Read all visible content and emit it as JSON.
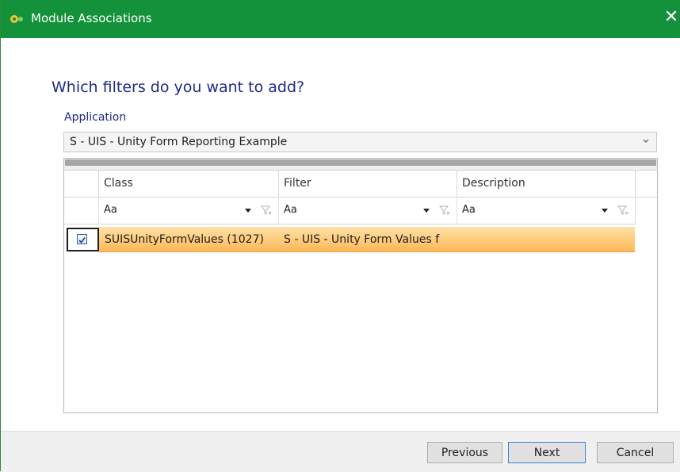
{
  "window": {
    "title": "Module Associations",
    "close_glyph": "✕"
  },
  "heading": "Which filters do you want to add?",
  "application": {
    "label": "Application",
    "selected": "S - UIS - Unity Form Reporting Example"
  },
  "grid": {
    "columns": [
      "Class",
      "Filter",
      "Description"
    ],
    "filter_placeholder": "Aa",
    "rows": [
      {
        "checked": true,
        "class": "SUISUnityFormValues (1027)",
        "filter": "S - UIS - Unity Form Values f",
        "description": ""
      }
    ]
  },
  "buttons": {
    "previous": "Previous",
    "next": "Next",
    "cancel": "Cancel"
  },
  "colors": {
    "titlebar": "#14913b",
    "heading": "#1f2a8a",
    "selected_row": "#fdb857"
  },
  "icons": {
    "app": "gear-icon",
    "close": "close-icon",
    "dropdown": "chevron-down-icon",
    "filter": "filter-clear-icon"
  }
}
